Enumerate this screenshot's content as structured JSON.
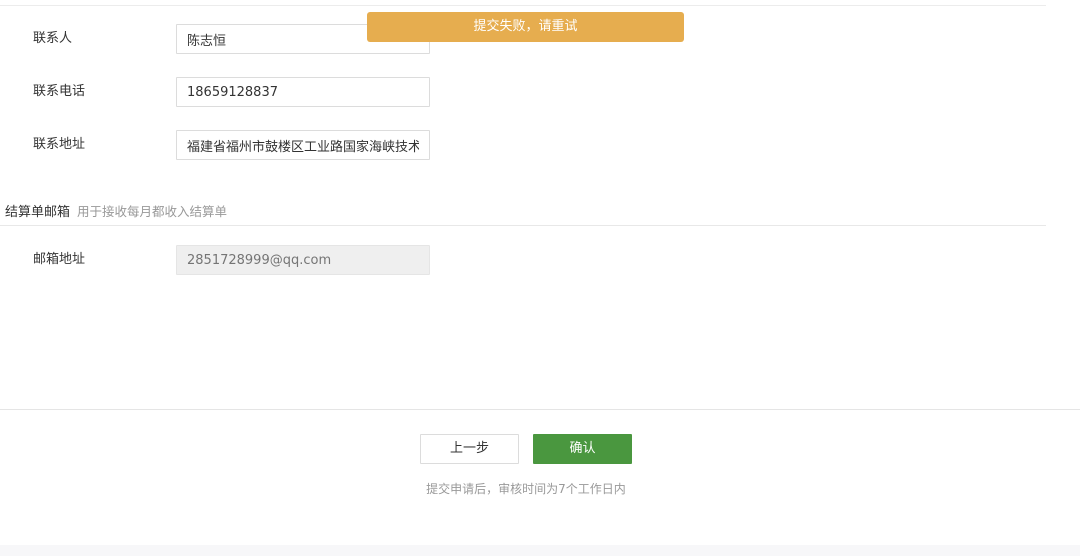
{
  "contact": {
    "rows": [
      {
        "label": "联系人",
        "value": "陈志恒"
      },
      {
        "label": "联系电话",
        "value": "18659128837"
      },
      {
        "label": "联系地址",
        "value": "福建省福州市鼓楼区工业路国家海峡技术"
      }
    ]
  },
  "statement_email": {
    "title": "结算单邮箱",
    "hint": "用于接收每月都收入结算单",
    "label": "邮箱地址",
    "placeholder": "2851728999@qq.com"
  },
  "toast": {
    "message": "提交失败，请重试",
    "color": "#e6ad4f"
  },
  "footer": {
    "prev_label": "上一步",
    "confirm_label": "确认",
    "note": "提交申请后，审核时间为7个工作日内",
    "confirm_color": "#4a973f"
  }
}
